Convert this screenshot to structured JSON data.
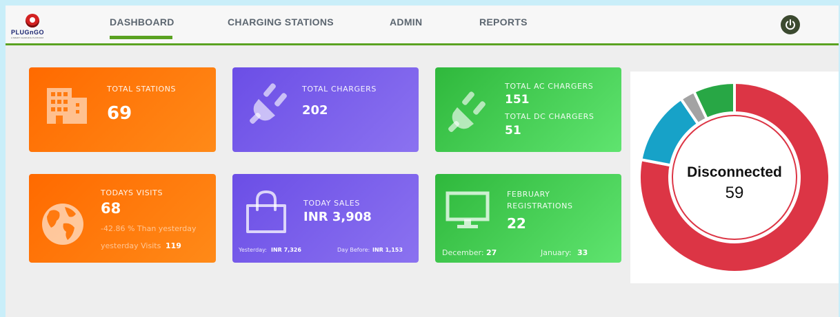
{
  "brand": {
    "name": "PLUGnGO",
    "tagline": "A SMART CHARGING PLATFORM"
  },
  "nav": {
    "items": [
      {
        "label": "DASHBOARD",
        "active": true
      },
      {
        "label": "CHARGING STATIONS",
        "active": false
      },
      {
        "label": "ADMIN",
        "active": false
      },
      {
        "label": "REPORTS",
        "active": false
      }
    ],
    "power_icon": "power-icon"
  },
  "cards": {
    "total_stations": {
      "label": "TOTAL STATIONS",
      "value": "69",
      "icon": "building-icon"
    },
    "total_chargers": {
      "label": "TOTAL CHARGERS",
      "value": "202",
      "icon": "plug-icon"
    },
    "ac_dc": {
      "ac_label": "TOTAL AC CHARGERS",
      "ac_value": "151",
      "dc_label": "TOTAL DC CHARGERS",
      "dc_value": "51",
      "icon": "plug-icon"
    },
    "todays_visits": {
      "label": "TODAYS VISITS",
      "value": "68",
      "change_text": "-42.86 % Than yesterday",
      "yesterday_label": "yesterday Visits",
      "yesterday_value": "119",
      "icon": "globe-icon"
    },
    "today_sales": {
      "label": "TODAY SALES",
      "value": "INR 3,908",
      "yesterday_label": "Yesterday:",
      "yesterday_value": "INR 7,326",
      "day_before_label": "Day Before:",
      "day_before_value": "INR 1,153",
      "icon": "shopping-bag-icon"
    },
    "registrations": {
      "label_line1": "FEBRUARY",
      "label_line2": "REGISTRATIONS",
      "value": "22",
      "december_label": "December:",
      "december_value": "27",
      "january_label": "January:",
      "january_value": "33",
      "icon": "monitor-icon"
    }
  },
  "donut": {
    "title": "Disconnected",
    "count": "59",
    "segments": [
      {
        "color": "#dc3545",
        "fraction": 0.78
      },
      {
        "color": "#17a2c8",
        "fraction": 0.125
      },
      {
        "color": "#a3a3a3",
        "fraction": 0.025
      },
      {
        "color": "#28a745",
        "fraction": 0.07
      }
    ]
  },
  "colors": {
    "accent": "#5aa221",
    "orange": "#ff7a0c",
    "purple": "#7a5fec",
    "green": "#45cf55"
  }
}
